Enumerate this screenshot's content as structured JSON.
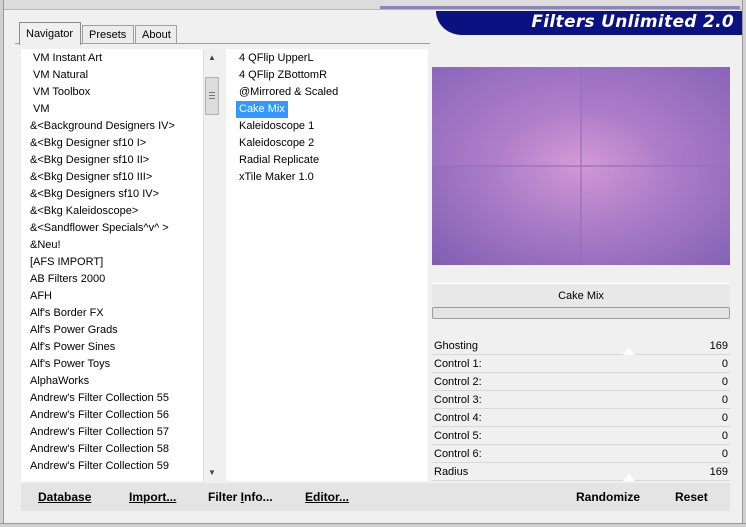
{
  "banner": {
    "title": "Filters Unlimited 2.0"
  },
  "tabs": [
    {
      "label": "Navigator",
      "active": true
    },
    {
      "label": "Presets",
      "active": false
    },
    {
      "label": "About",
      "active": false
    }
  ],
  "categories": [
    "VM Instant Art",
    "VM Natural",
    "VM Toolbox",
    "VM",
    "&<Background Designers IV>",
    "&<Bkg Designer sf10 I>",
    "&<Bkg Designer sf10 II>",
    "&<Bkg Designer sf10 III>",
    "&<Bkg Designers sf10 IV>",
    "&<Bkg Kaleidoscope>",
    "&<Sandflower Specials^v^ >",
    "&Neu!",
    "[AFS IMPORT]",
    "AB Filters 2000",
    "AFH",
    "Alf's Border FX",
    "Alf's Power Grads",
    "Alf's Power Sines",
    "Alf's Power Toys",
    "AlphaWorks",
    "Andrew's Filter Collection 55",
    "Andrew's Filter Collection 56",
    "Andrew's Filter Collection 57",
    "Andrew's Filter Collection 58",
    "Andrew's Filter Collection 59"
  ],
  "filters": [
    {
      "label": "4 QFlip UpperL",
      "selected": false
    },
    {
      "label": "4 QFlip ZBottomR",
      "selected": false
    },
    {
      "label": "@Mirrored & Scaled",
      "selected": false
    },
    {
      "label": "Cake Mix",
      "selected": true
    },
    {
      "label": "Kaleidoscope 1",
      "selected": false
    },
    {
      "label": "Kaleidoscope 2",
      "selected": false
    },
    {
      "label": "Radial Replicate",
      "selected": false
    },
    {
      "label": "xTile Maker 1.0",
      "selected": false
    }
  ],
  "preview": {
    "filter_name": "Cake Mix"
  },
  "controls": [
    {
      "label": "Ghosting",
      "value": "169",
      "level": 0.66
    },
    {
      "label": "Control 1:",
      "value": "0",
      "level": 0
    },
    {
      "label": "Control 2:",
      "value": "0",
      "level": 0
    },
    {
      "label": "Control 3:",
      "value": "0",
      "level": 0
    },
    {
      "label": "Control 4:",
      "value": "0",
      "level": 0
    },
    {
      "label": "Control 5:",
      "value": "0",
      "level": 0
    },
    {
      "label": "Control 6:",
      "value": "0",
      "level": 0
    },
    {
      "label": "Radius",
      "value": "169",
      "level": 0.66
    }
  ],
  "buttons": {
    "database": {
      "key": "D",
      "rest": "atabase"
    },
    "import": {
      "pre": "Im",
      "key": "p",
      "rest": "ort..."
    },
    "filter_info": {
      "pre": "Filter ",
      "key": "I",
      "rest": "nfo..."
    },
    "editor": {
      "key": "E",
      "rest": "ditor..."
    },
    "randomize": "Randomize",
    "reset": "Reset"
  },
  "colors": {
    "banner_bg": "#0a1180",
    "selection": "#3399ff"
  }
}
